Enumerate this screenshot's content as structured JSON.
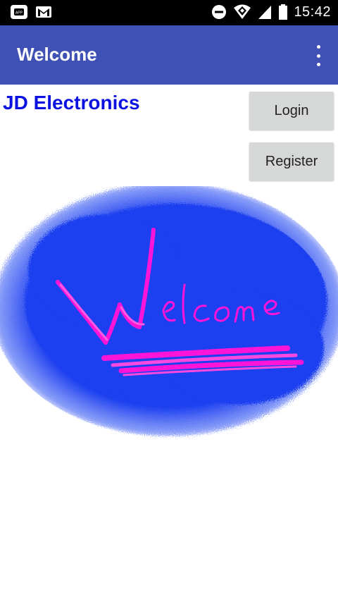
{
  "status_bar": {
    "time": "15:42",
    "icons": [
      "app-icon",
      "gmail-icon",
      "do-not-disturb-icon",
      "wifi-icon",
      "signal-icon",
      "battery-icon"
    ]
  },
  "app_bar": {
    "title": "Welcome",
    "overflow_icon": "more-vert-icon"
  },
  "main": {
    "store_name": "JD Electronics",
    "login_label": "Login",
    "register_label": "Register",
    "banner": {
      "text": "Welcome",
      "background_color": "#1e3ff0",
      "text_color": "#ff14d8"
    }
  },
  "colors": {
    "app_bar": "#3f51b5",
    "store_name": "#0b12e0",
    "button_bg": "#d6d7d7"
  }
}
